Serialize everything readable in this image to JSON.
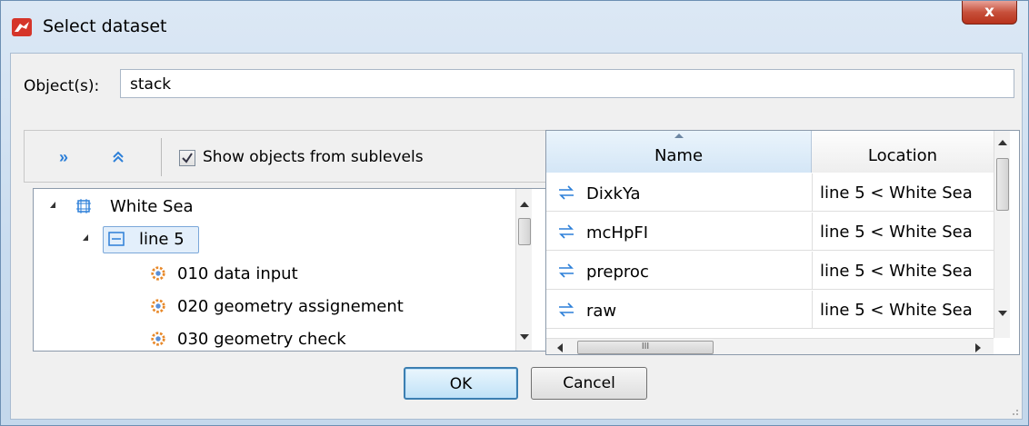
{
  "window": {
    "title": "Select dataset",
    "close_label": "x",
    "accent_color": "#d5352a"
  },
  "object_field": {
    "label": "Object(s):",
    "value": "stack"
  },
  "toolbar": {
    "expand_icon": "»",
    "collapse_icon": "double-chevron-up-icon",
    "show_sublevels_label": "Show objects from sublevels",
    "show_sublevels_checked": true
  },
  "tree": {
    "root": "White Sea",
    "line": "line 5",
    "items": [
      "010 data input",
      "020 geometry assignement",
      "030 geometry check"
    ]
  },
  "grid": {
    "columns": [
      "Name",
      "Location"
    ],
    "rows": [
      {
        "name": "DixkYa",
        "location": "line 5 < White Sea"
      },
      {
        "name": "mcHpFI",
        "location": "line 5 < White Sea"
      },
      {
        "name": "preproc",
        "location": "line 5 < White Sea"
      },
      {
        "name": "raw",
        "location": "line 5 < White Sea"
      }
    ],
    "hscroll_grip": "III"
  },
  "buttons": {
    "ok": "OK",
    "cancel": "Cancel"
  }
}
